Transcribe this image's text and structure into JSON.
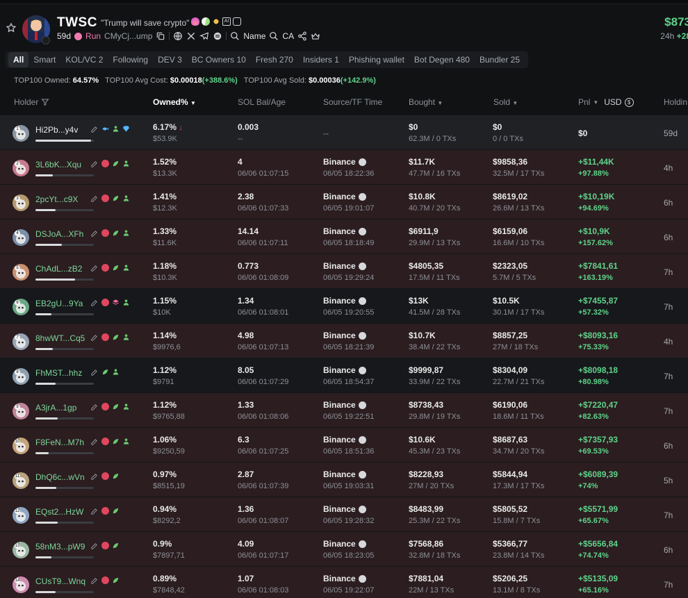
{
  "token": {
    "name": "TWSC",
    "description": "\"Trump will save crypto\"",
    "age": "59d",
    "run_label": "Run",
    "contract_short": "CMyCj...ump",
    "name_label": "Name",
    "ca_label": "CA",
    "price": "$873",
    "change_prefix": "24h",
    "change_value": "+28"
  },
  "tabs": [
    "All",
    "Smart",
    "KOL/VC 2",
    "Following",
    "DEV 3",
    "BC Owners 10",
    "Fresh 270",
    "Insiders 1",
    "Phishing wallet",
    "Bot Degen 480",
    "Bundler 25"
  ],
  "stats": {
    "owned_label": "TOP100 Owned:",
    "owned_value": "64.57%",
    "cost_label": "TOP100 Avg Cost:",
    "cost_value": "$0.00018",
    "cost_change": "(+388.6%)",
    "sold_label": "TOP100 Avg Sold:",
    "sold_value": "$0.00036",
    "sold_change": "(+142.9%)"
  },
  "columns": {
    "holder": "Holder",
    "owned": "Owned%",
    "sol": "SOL Bal/Age",
    "source": "Source/TF Time",
    "bought": "Bought",
    "sold": "Sold",
    "pnl": "Pnl",
    "usd": "USD",
    "holding": "Holdin"
  },
  "rows": [
    {
      "rank": "1",
      "holder": "Hi2Pb...y4v",
      "owned": "6.17%",
      "owned_usd": "$53.9K",
      "sol": "0.003",
      "age": "--",
      "source": "--",
      "tf": "",
      "bought": "$0",
      "bought_tx": "62.3M / 0 TXs",
      "sold": "$0",
      "sold_tx": "0 / 0 TXs",
      "pnl": "$0",
      "pnl_pct": "",
      "hold": "59d",
      "bar": 0.95,
      "badges": [
        "fish",
        "user",
        "diamond"
      ]
    },
    {
      "rank": "2",
      "holder": "3L6bK...Xqu",
      "owned": "1.52%",
      "owned_usd": "$13.3K",
      "sol": "4",
      "age": "06/06 01:07:15",
      "source": "Binance",
      "tf": "06/05 18:22:36",
      "bought": "$11.7K",
      "bought_tx": "47.7M / 16 TXs",
      "sold": "$9858,36",
      "sold_tx": "32.5M / 17 TXs",
      "pnl": "+$11,44K",
      "pnl_pct": "+97.88%",
      "hold": "4h",
      "bar": 0.3,
      "badges": [
        "red",
        "leaf",
        "user"
      ]
    },
    {
      "rank": "3",
      "holder": "2pcYt...c9X",
      "owned": "1.41%",
      "owned_usd": "$12.3K",
      "sol": "2.38",
      "age": "06/06 01:07:33",
      "source": "Binance",
      "tf": "06/05 19:01:07",
      "bought": "$10.8K",
      "bought_tx": "40.7M / 20 TXs",
      "sold": "$8619,02",
      "sold_tx": "26.6M / 13 TXs",
      "pnl": "+$10,19K",
      "pnl_pct": "+94.69%",
      "hold": "6h",
      "bar": 0.34,
      "badges": [
        "red",
        "leaf",
        "user"
      ]
    },
    {
      "rank": "4",
      "holder": "DSJoA...XFh",
      "owned": "1.33%",
      "owned_usd": "$11.6K",
      "sol": "14.14",
      "age": "06/06 01:07:11",
      "source": "Binance",
      "tf": "06/05 18:18:49",
      "bought": "$6911,9",
      "bought_tx": "29.9M / 13 TXs",
      "sold": "$6159,06",
      "sold_tx": "16.6M / 10 TXs",
      "pnl": "+$10,9K",
      "pnl_pct": "+157.62%",
      "hold": "6h",
      "bar": 0.45,
      "badges": [
        "red",
        "leaf",
        "user"
      ]
    },
    {
      "rank": "5",
      "holder": "ChAdL...zB2",
      "owned": "1.18%",
      "owned_usd": "$10.3K",
      "sol": "0.773",
      "age": "06/06 01:08:09",
      "source": "Binance",
      "tf": "06/05 19:29:24",
      "bought": "$4805,35",
      "bought_tx": "17.5M / 11 TXs",
      "sold": "$2323,05",
      "sold_tx": "5.7M / 5 TXs",
      "pnl": "+$7841,61",
      "pnl_pct": "+163.19%",
      "hold": "7h",
      "bar": 0.68,
      "badges": [
        "red",
        "leaf",
        "user"
      ]
    },
    {
      "rank": "6",
      "holder": "EB2gU...9Ya",
      "owned": "1.15%",
      "owned_usd": "$10K",
      "sol": "1.34",
      "age": "06/06 01:08:01",
      "source": "Binance",
      "tf": "06/05 19:20:55",
      "bought": "$13K",
      "bought_tx": "41.5M / 28 TXs",
      "sold": "$10.5K",
      "sold_tx": "30.1M / 17 TXs",
      "pnl": "+$7455,87",
      "pnl_pct": "+57.32%",
      "hold": "7h",
      "bar": 0.27,
      "badges": [
        "red",
        "stack",
        "user"
      ]
    },
    {
      "rank": "7",
      "holder": "8hwWT...Cq5",
      "owned": "1.14%",
      "owned_usd": "$9976,6",
      "sol": "4.98",
      "age": "06/06 01:07:13",
      "source": "Binance",
      "tf": "06/05 18:21:39",
      "bought": "$10.7K",
      "bought_tx": "38.4M / 22 TXs",
      "sold": "$8857,25",
      "sold_tx": "27M / 18 TXs",
      "pnl": "+$8093,16",
      "pnl_pct": "+75.33%",
      "hold": "4h",
      "bar": 0.3,
      "badges": [
        "red",
        "leaf",
        "user"
      ]
    },
    {
      "rank": "8",
      "holder": "FhMST...hhz",
      "owned": "1.12%",
      "owned_usd": "$9791",
      "sol": "8.05",
      "age": "06/06 01:07:29",
      "source": "Binance",
      "tf": "06/05 18:54:37",
      "bought": "$9999,87",
      "bought_tx": "33.9M / 22 TXs",
      "sold": "$8304,09",
      "sold_tx": "22.7M / 21 TXs",
      "pnl": "+$8098,18",
      "pnl_pct": "+80.98%",
      "hold": "7h",
      "bar": 0.34,
      "badges": [
        "leaf",
        "user"
      ]
    },
    {
      "rank": "9",
      "holder": "A3jrA...1gp",
      "owned": "1.12%",
      "owned_usd": "$9765,88",
      "sol": "1.33",
      "age": "06/06 01:08:06",
      "source": "Binance",
      "tf": "06/05 19:22:51",
      "bought": "$8738,43",
      "bought_tx": "29.8M / 19 TXs",
      "sold": "$6190,06",
      "sold_tx": "18.6M / 11 TXs",
      "pnl": "+$7220,47",
      "pnl_pct": "+82.63%",
      "hold": "7h",
      "bar": 0.38,
      "badges": [
        "red",
        "leaf",
        "user"
      ]
    },
    {
      "rank": "10",
      "holder": "F8FeN...M7h",
      "owned": "1.06%",
      "owned_usd": "$9250,59",
      "sol": "6.3",
      "age": "06/06 01:07:25",
      "source": "Binance",
      "tf": "06/05 18:51:36",
      "bought": "$10.6K",
      "bought_tx": "45.3M / 23 TXs",
      "sold": "$8687,63",
      "sold_tx": "34.7M / 20 TXs",
      "pnl": "+$7357,93",
      "pnl_pct": "+69.53%",
      "hold": "6h",
      "bar": 0.23,
      "badges": [
        "red",
        "leaf",
        "user"
      ]
    },
    {
      "rank": "11",
      "holder": "DhQ6c...wVn",
      "owned": "0.97%",
      "owned_usd": "$8515,19",
      "sol": "2.87",
      "age": "06/06 01:07:39",
      "source": "Binance",
      "tf": "06/05 19:03:31",
      "bought": "$8228,93",
      "bought_tx": "27M / 20 TXs",
      "sold": "$5844,94",
      "sold_tx": "17.3M / 17 TXs",
      "pnl": "+$6089,39",
      "pnl_pct": "+74%",
      "hold": "5h",
      "bar": 0.36,
      "badges": [
        "red",
        "leaf"
      ]
    },
    {
      "rank": "12",
      "holder": "EQst2...HzW",
      "owned": "0.94%",
      "owned_usd": "$8292,2",
      "sol": "1.36",
      "age": "06/06 01:08:07",
      "source": "Binance",
      "tf": "06/05 19:28:32",
      "bought": "$8483,99",
      "bought_tx": "25.3M / 22 TXs",
      "sold": "$5805,52",
      "sold_tx": "15.8M / 7 TXs",
      "pnl": "+$5571,99",
      "pnl_pct": "+65.67%",
      "hold": "7h",
      "bar": 0.38,
      "badges": [
        "red",
        "leaf"
      ]
    },
    {
      "rank": "13",
      "holder": "58nM3...pW9",
      "owned": "0.9%",
      "owned_usd": "$7897,71",
      "sol": "4.09",
      "age": "06/06 01:07:17",
      "source": "Binance",
      "tf": "06/05 18:23:05",
      "bought": "$7568,86",
      "bought_tx": "32.8M / 18 TXs",
      "sold": "$5366,77",
      "sold_tx": "23.8M / 14 TXs",
      "pnl": "+$5656,84",
      "pnl_pct": "+74.74%",
      "hold": "6h",
      "bar": 0.27,
      "badges": [
        "red",
        "leaf"
      ]
    },
    {
      "rank": "14",
      "holder": "CUsT9...Wnq",
      "owned": "0.89%",
      "owned_usd": "$7848,42",
      "sol": "1.07",
      "age": "06/06 01:08:03",
      "source": "Binance",
      "tf": "06/05 19:22:07",
      "bought": "$7881,04",
      "bought_tx": "22M / 13 TXs",
      "sold": "$5206,25",
      "sold_tx": "13.1M / 8 TXs",
      "pnl": "+$5135,09",
      "pnl_pct": "+65.16%",
      "hold": "7h",
      "bar": 0.34,
      "badges": [
        "red",
        "leaf"
      ]
    }
  ],
  "colors": {
    "accent_green": "#5fd38a",
    "row_red": "#2b1d20",
    "row_dark": "#17181b",
    "badge_red": "#e0475f"
  },
  "icons": [
    "star-icon",
    "fire-icon",
    "pill-icon",
    "people-icon",
    "ai-icon",
    "copy-icon",
    "globe-icon",
    "x-icon",
    "telegram-icon",
    "search-icon",
    "share-icon",
    "crown-icon",
    "filter-icon",
    "edit-icon",
    "usd-toggle-icon",
    "arrow-down-icon",
    "binance-icon"
  ]
}
